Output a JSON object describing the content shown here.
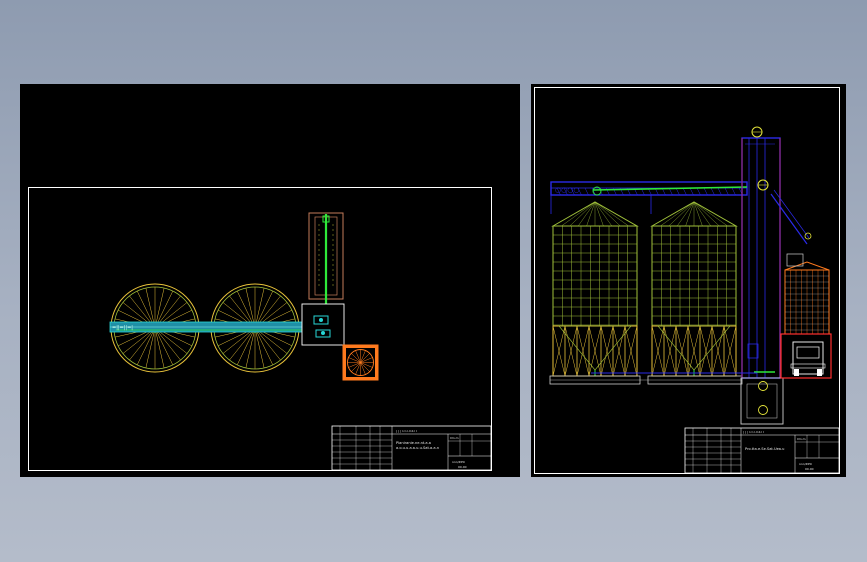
{
  "colors": {
    "frame": "#ffffff",
    "silo": "#9fc03a",
    "silo_base": "#e8c23a",
    "conveyor_blue": "#2a2ae8",
    "conveyor_green": "#2ee83a",
    "cyan": "#27d6d6",
    "orange": "#ff7a1e",
    "red": "#ff3030",
    "brown": "#c57c5a",
    "yellow": "#e6e63a"
  },
  "left_drawing": {
    "title_block": {
      "rev_text": "| | | l.l l.l.ll.ll.l l",
      "title_line_1": "Planiranie.ne.nt.a.a",
      "title_line_2": "a.o.u.u.a.a.u.u.Sat.a.a.n",
      "field_1": "Ilm.m",
      "sheet_code": "nnn/P.P0",
      "sheet_no": "00.00"
    }
  },
  "right_drawing": {
    "title_block": {
      "rev_text": "| | | l.l l.l.ll.ll.l l",
      "title_line_1": "Pro.tta.e.Se.Sat.Uea.u",
      "field_1": "Ilm.m",
      "sheet_code": "nnn/P.P0",
      "sheet_no": "00.00"
    }
  }
}
